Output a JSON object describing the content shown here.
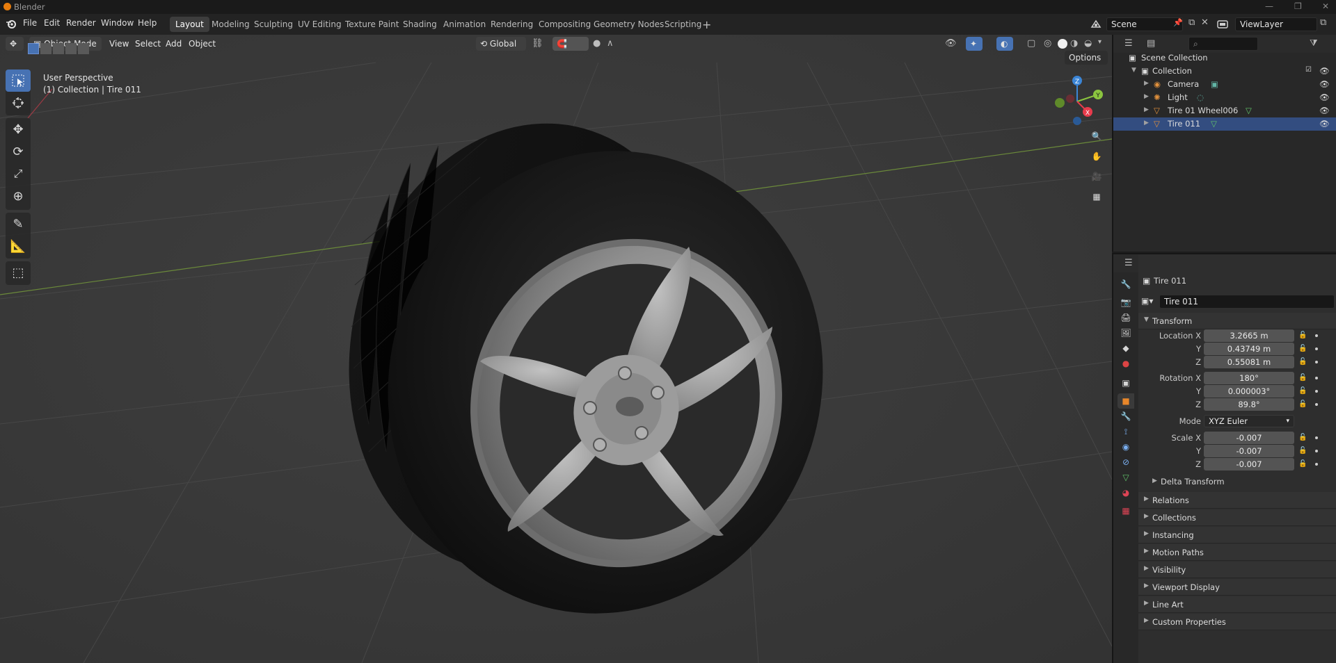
{
  "window": {
    "title": "Blender"
  },
  "menubar": {
    "items": [
      "File",
      "Edit",
      "Render",
      "Window",
      "Help"
    ]
  },
  "workspaces": [
    "Layout",
    "Modeling",
    "Sculpting",
    "UV Editing",
    "Texture Paint",
    "Shading",
    "Animation",
    "Rendering",
    "Compositing",
    "Geometry Nodes",
    "Scripting"
  ],
  "active_workspace": "Layout",
  "scene": {
    "name": "Scene"
  },
  "view_layer": {
    "name": "ViewLayer"
  },
  "viewport": {
    "mode": "Object Mode",
    "menus": [
      "View",
      "Select",
      "Add",
      "Object"
    ],
    "orientation": "Global",
    "options_label": "Options",
    "view_name": "User Perspective",
    "context_line": "(1) Collection | Tire 011",
    "gizmo_axes": {
      "x": "X",
      "y": "Y",
      "z": "Z"
    }
  },
  "outliner": {
    "root": "Scene Collection",
    "collection": "Collection",
    "items": [
      {
        "name": "Camera",
        "icon": "camera-icon"
      },
      {
        "name": "Light",
        "icon": "light-icon"
      },
      {
        "name": "Tire 01 Wheel006",
        "icon": "mesh-icon"
      },
      {
        "name": "Tire 011",
        "icon": "mesh-icon"
      }
    ]
  },
  "properties": {
    "object_name": "Tire 011",
    "object_field": "Tire 011",
    "transform_header": "Transform",
    "location_label": "Location X",
    "rotation_label": "Rotation X",
    "scale_label": "Scale X",
    "axis_y": "Y",
    "axis_z": "Z",
    "location": [
      "3.2665 m",
      "0.43749 m",
      "0.55081 m"
    ],
    "rotation": [
      "180°",
      "0.000003°",
      "89.8°"
    ],
    "mode_label": "Mode",
    "mode_value": "XYZ Euler",
    "scale": [
      "-0.007",
      "-0.007",
      "-0.007"
    ],
    "delta_transform": "Delta Transform",
    "panels": [
      "Relations",
      "Collections",
      "Instancing",
      "Motion Paths",
      "Visibility",
      "Viewport Display",
      "Line Art",
      "Custom Properties"
    ]
  },
  "colors": {
    "accent": "#4772b3",
    "x_axis": "#e83b4c",
    "y_axis": "#8bc43f",
    "z_axis": "#3b85d6",
    "blender_orange": "#e87d0d"
  }
}
